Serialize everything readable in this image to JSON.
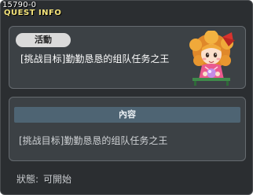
{
  "quest_id": "15790-0",
  "window_title": "QUEST INFO",
  "top_panel": {
    "badge": "活動",
    "quest_name": "[挑战目标]勤勤恳恳的组队任务之王"
  },
  "npc": {
    "icon": "npc-girl-portrait"
  },
  "content_panel": {
    "header": "內容",
    "description": "[挑战目标]勤勤恳恳的组队任务之王"
  },
  "status": {
    "label": "狀態:",
    "value": "可開始"
  }
}
